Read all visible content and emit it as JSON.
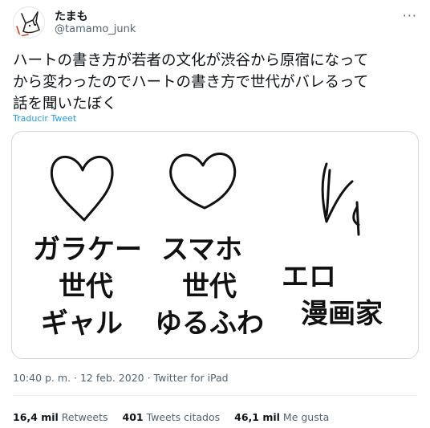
{
  "author": {
    "name": "たまも",
    "handle": "@tamamo_junk"
  },
  "header": {
    "more_label": "···"
  },
  "tweet": {
    "text": "ハートの書き方が若者の文化が渋谷から原宿になって\nから変わったのでハートの書き方で世代がバレるって\n話を聞いたぼく",
    "translate_label": "Traducir Tweet"
  },
  "media": {
    "columns": [
      {
        "lines": [
          "ガラケー",
          "世代",
          "ギャル"
        ]
      },
      {
        "lines": [
          "スマホ",
          "世代",
          "ゆるふわ"
        ]
      },
      {
        "lines": [
          "エロ",
          "漫画家"
        ]
      }
    ]
  },
  "meta": {
    "time": "10:40 p. m.",
    "date": "12 feb. 2020",
    "source": "Twitter for iPad"
  },
  "stats": {
    "retweets_count": "16,4 mil",
    "retweets_label": "Retweets",
    "quotes_count": "401",
    "quotes_label": "Tweets citados",
    "likes_count": "46,1 mil",
    "likes_label": "Me gusta"
  }
}
